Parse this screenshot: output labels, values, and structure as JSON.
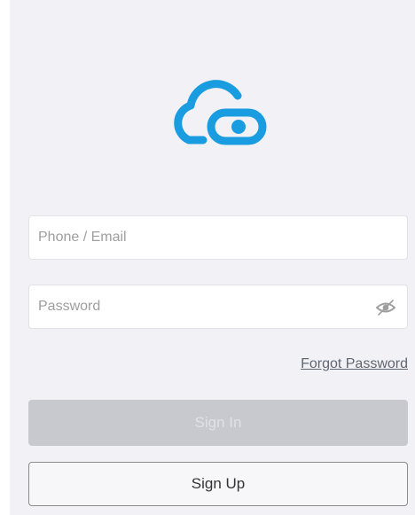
{
  "app": {
    "logo_icon": "cloud-eye-icon",
    "brand_color": "#1a9de0"
  },
  "form": {
    "phone": {
      "placeholder": "Phone / Email",
      "value": ""
    },
    "password": {
      "placeholder": "Password",
      "value": "",
      "toggle_icon": "eye-icon"
    },
    "forgot_label": "Forgot Password",
    "sign_in_label": "Sign In",
    "sign_in_state": "disabled",
    "sign_up_label": "Sign Up"
  }
}
